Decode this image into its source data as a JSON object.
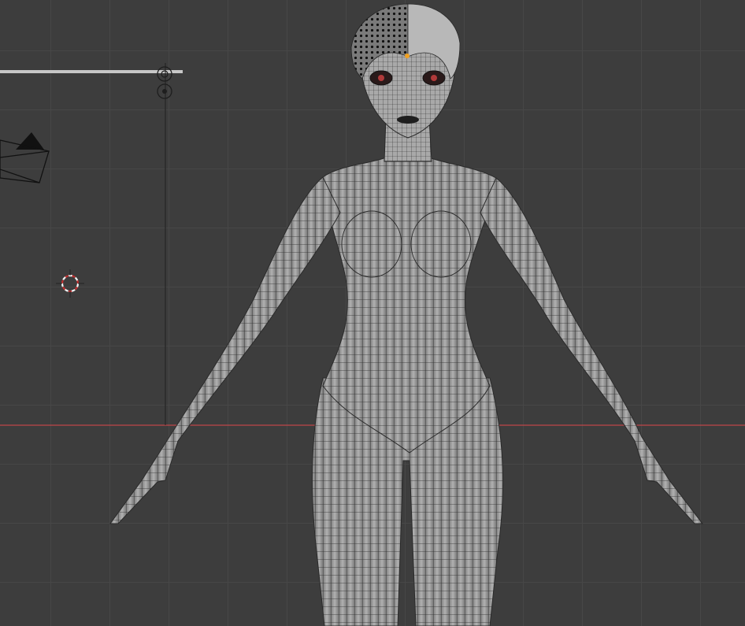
{
  "app": {
    "name": "3D Viewport"
  },
  "viewport": {
    "background_color": "#3d3d3d",
    "grid_color": "#474747",
    "x_axis_color": "#c04548",
    "mesh_fill_color": "#9b9b9b",
    "wire_color": "#2a2a2a"
  },
  "scene_objects": [
    {
      "name": "camera-icon"
    },
    {
      "name": "light-icon"
    },
    {
      "name": "3d-cursor-icon"
    },
    {
      "name": "character-mesh"
    }
  ]
}
